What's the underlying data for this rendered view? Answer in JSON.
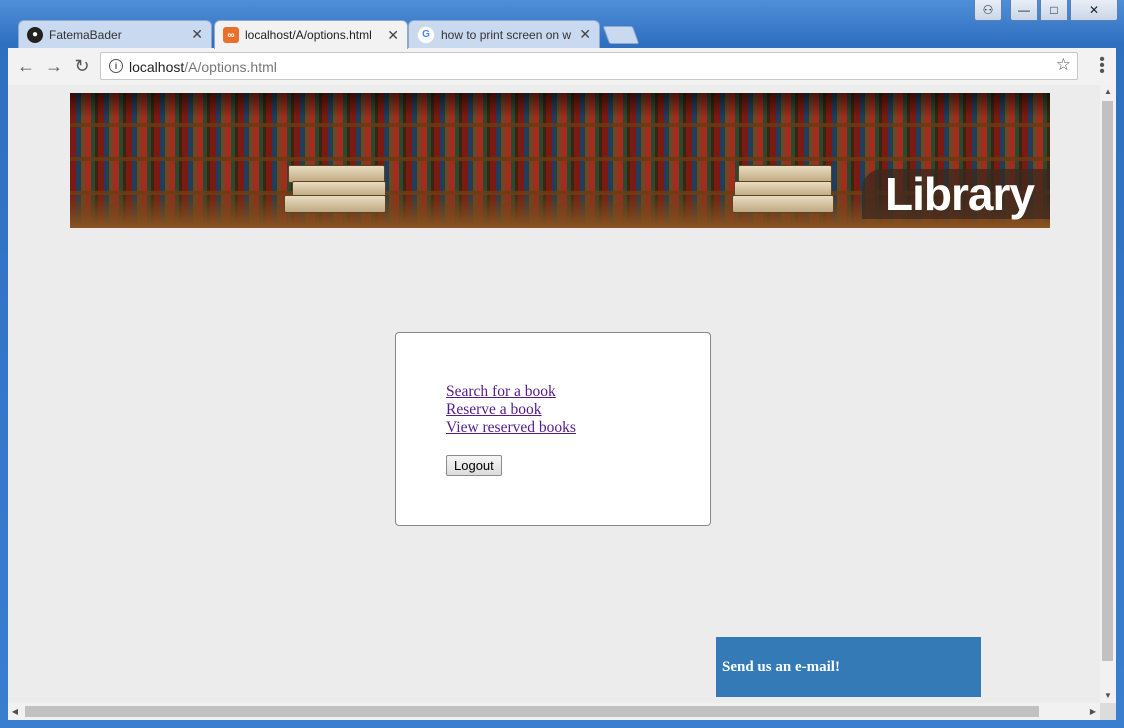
{
  "browser": {
    "tabs": [
      {
        "title": "FatemaBader",
        "icon": "github-icon",
        "active": false
      },
      {
        "title": "localhost/A/options.html",
        "icon": "xampp-icon",
        "active": true
      },
      {
        "title": "how to print screen on w",
        "icon": "google-icon",
        "active": false
      }
    ],
    "url_host": "localhost",
    "url_path": "/A/options.html"
  },
  "page": {
    "banner_title": "Library",
    "links": [
      "Search for a book",
      "Reserve a book",
      "View reserved books"
    ],
    "logout_label": "Logout",
    "email_label": "Send us an e-mail!"
  },
  "colors": {
    "link_visited": "#551a8b",
    "email_box": "#337ab7",
    "page_bg": "#ececec"
  }
}
